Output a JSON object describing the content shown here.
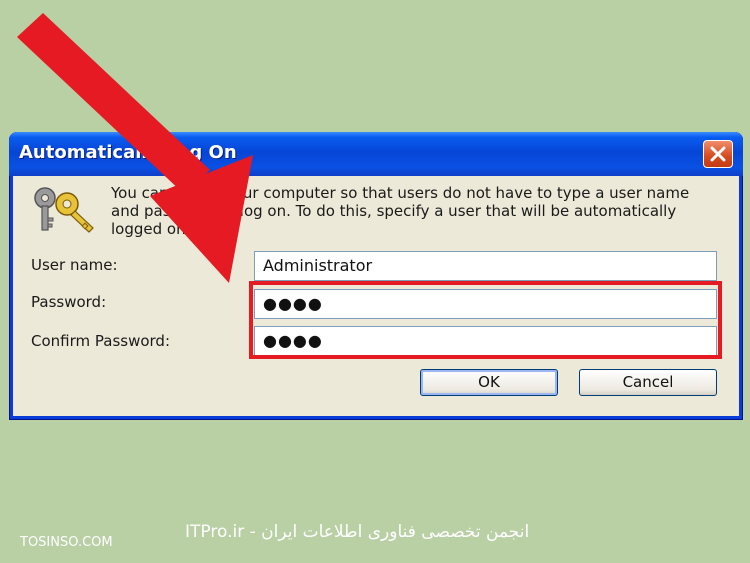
{
  "dialog": {
    "title": "Automatically Log On",
    "intro": "You can set up your computer so that users do not have to type a user name and password to log on. To do this, specify a user that will be automatically logged on below:",
    "fields": {
      "user_label": "User name:",
      "user_value": "Administrator",
      "password_label": "Password:",
      "password_value": "●●●●",
      "confirm_label": "Confirm Password:",
      "confirm_value": "●●●●"
    },
    "buttons": {
      "ok": "OK",
      "cancel": "Cancel"
    },
    "icons": {
      "close": "close-icon",
      "keys": "keys-icon"
    }
  },
  "annotation": {
    "arrow_color": "#e51a23",
    "highlight_color": "#e51a23"
  },
  "footer": {
    "left": "TOSINSO.COM",
    "center": "ITPro.ir - انجمن تخصصی فناوری اطلاعات ایران"
  },
  "colors": {
    "background": "#b9cfa4",
    "titlebar": "#0a50e4",
    "client": "#ece9d8"
  }
}
